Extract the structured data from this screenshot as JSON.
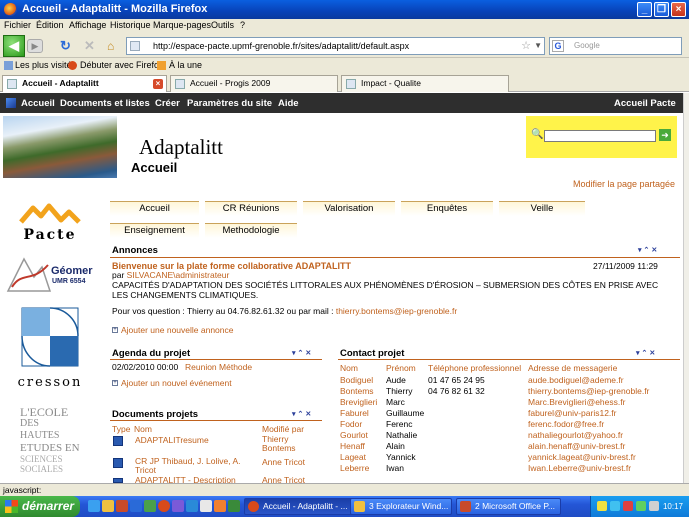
{
  "window": {
    "title": "Accueil - Adaptalitt - Mozilla Firefox"
  },
  "menu": [
    "Fichier",
    "Édition",
    "Affichage",
    "Historique",
    "Marque-pages",
    "Outils",
    "?"
  ],
  "nav": {
    "url": "http://espace-pacte.upmf-grenoble.fr/sites/adaptalitt/default.aspx",
    "search_placeholder": "Google",
    "search_engine": "G"
  },
  "bookmarks": [
    "Les plus visités",
    "Débuter avec Firefox",
    "À la une"
  ],
  "tabs": [
    {
      "label": "Accueil - Adaptalitt",
      "active": true
    },
    {
      "label": "Accueil - Progis 2009",
      "active": false
    },
    {
      "label": "Impact - Qualite",
      "active": false
    }
  ],
  "sp_nav": {
    "items": [
      "Accueil",
      "Documents et listes",
      "Créer",
      "Paramètres du site",
      "Aide"
    ],
    "right": "Accueil Pacte"
  },
  "site": {
    "title": "Adaptalitt",
    "page": "Accueil",
    "modify_link": "Modifier la page partagée"
  },
  "logos": {
    "pacte": "Pacte",
    "geomer": "Géomer",
    "geomer_umr": "UMR 6554",
    "cresson": "cresson",
    "ehess": [
      "L'ECOLE",
      "DES HAUTES",
      "ETUDES EN",
      "SCIENCES",
      "SOCIALES"
    ]
  },
  "topnav": {
    "row1": [
      "Accueil",
      "CR Réunions",
      "Valorisation",
      "Enquêtes",
      "Veille"
    ],
    "row2": [
      "Enseignement",
      "Methodologie"
    ]
  },
  "annonces": {
    "title": "Annonces",
    "item_title": "Bienvenue sur la plate forme collaborative ADAPTALITT",
    "date": "27/11/2009 11:29",
    "by_prefix": "par",
    "author": "SILVACANE\\administrateur",
    "body": "CAPACITÉS D'ADAPTATION DES SOCIÉTÉS LITTORALES AUX PHÉNOMÈNES D'ÉROSION – SUBMERSION DES CÔTES EN PRISE AVEC LES CHANGEMENTS CLIMATIQUES.",
    "question": "Pour vos question : Thierry au 04.76.82.61.32 ou par mail :",
    "email": "thierry.bontems@iep-grenoble.fr",
    "add": "Ajouter une nouvelle annonce"
  },
  "agenda": {
    "title": "Agenda du projet",
    "date": "02/02/2010 00:00",
    "event": "Reunion Méthode",
    "add": "Ajouter un nouvel événement"
  },
  "documents": {
    "title": "Documents projets",
    "headers": [
      "Type",
      "Nom",
      "Modifié par"
    ],
    "rows": [
      {
        "name": "ADAPTALITresume",
        "by": "Thierry Bontems"
      },
      {
        "name": "CR JP Thibaud, J. Lolive, A. Tricot",
        "by": "Anne Tricot"
      },
      {
        "name": "ADAPTALITT - Description",
        "by": "Anne Tricot"
      }
    ]
  },
  "contacts": {
    "title": "Contact projet",
    "headers": [
      "Nom",
      "Prénom",
      "Téléphone professionnel",
      "Adresse de messagerie"
    ],
    "rows": [
      {
        "nom": "Bodiguel",
        "prenom": "Aude",
        "tel": "01 47 65 24 95",
        "mail": "aude.bodiguel@ademe.fr"
      },
      {
        "nom": "Bontems",
        "prenom": "Thierry",
        "tel": "04 76 82 61 32",
        "mail": "thierry.bontems@iep-grenoble.fr"
      },
      {
        "nom": "Breviglieri",
        "prenom": "Marc",
        "tel": "",
        "mail": "Marc.Breviglieri@ehess.fr"
      },
      {
        "nom": "Faburel",
        "prenom": "Guillaume",
        "tel": "",
        "mail": "faburel@univ-paris12.fr"
      },
      {
        "nom": "Fodor",
        "prenom": "Ferenc",
        "tel": "",
        "mail": "ferenc.fodor@free.fr"
      },
      {
        "nom": "Gourlot",
        "prenom": "Nathalie",
        "tel": "",
        "mail": "nathaliegourlot@yahoo.fr"
      },
      {
        "nom": "Henaff",
        "prenom": "Alain",
        "tel": "",
        "mail": "alain.henaff@univ-brest.fr"
      },
      {
        "nom": "Lageat",
        "prenom": "Yannick",
        "tel": "",
        "mail": "yannick.lageat@univ-brest.fr"
      },
      {
        "nom": "Leberre",
        "prenom": "Iwan",
        "tel": "",
        "mail": "Iwan.Leberre@univ-brest.fr"
      }
    ]
  },
  "status": "javascript:",
  "taskbar": {
    "start": "démarrer",
    "buttons": [
      "Accueil - Adaptalitt - ...",
      "3 Explorateur Wind...",
      "2 Microsoft Office P..."
    ],
    "clock": "10:17"
  },
  "colors": {
    "accent": "#c0621e",
    "navy": "#2b3f9a"
  }
}
